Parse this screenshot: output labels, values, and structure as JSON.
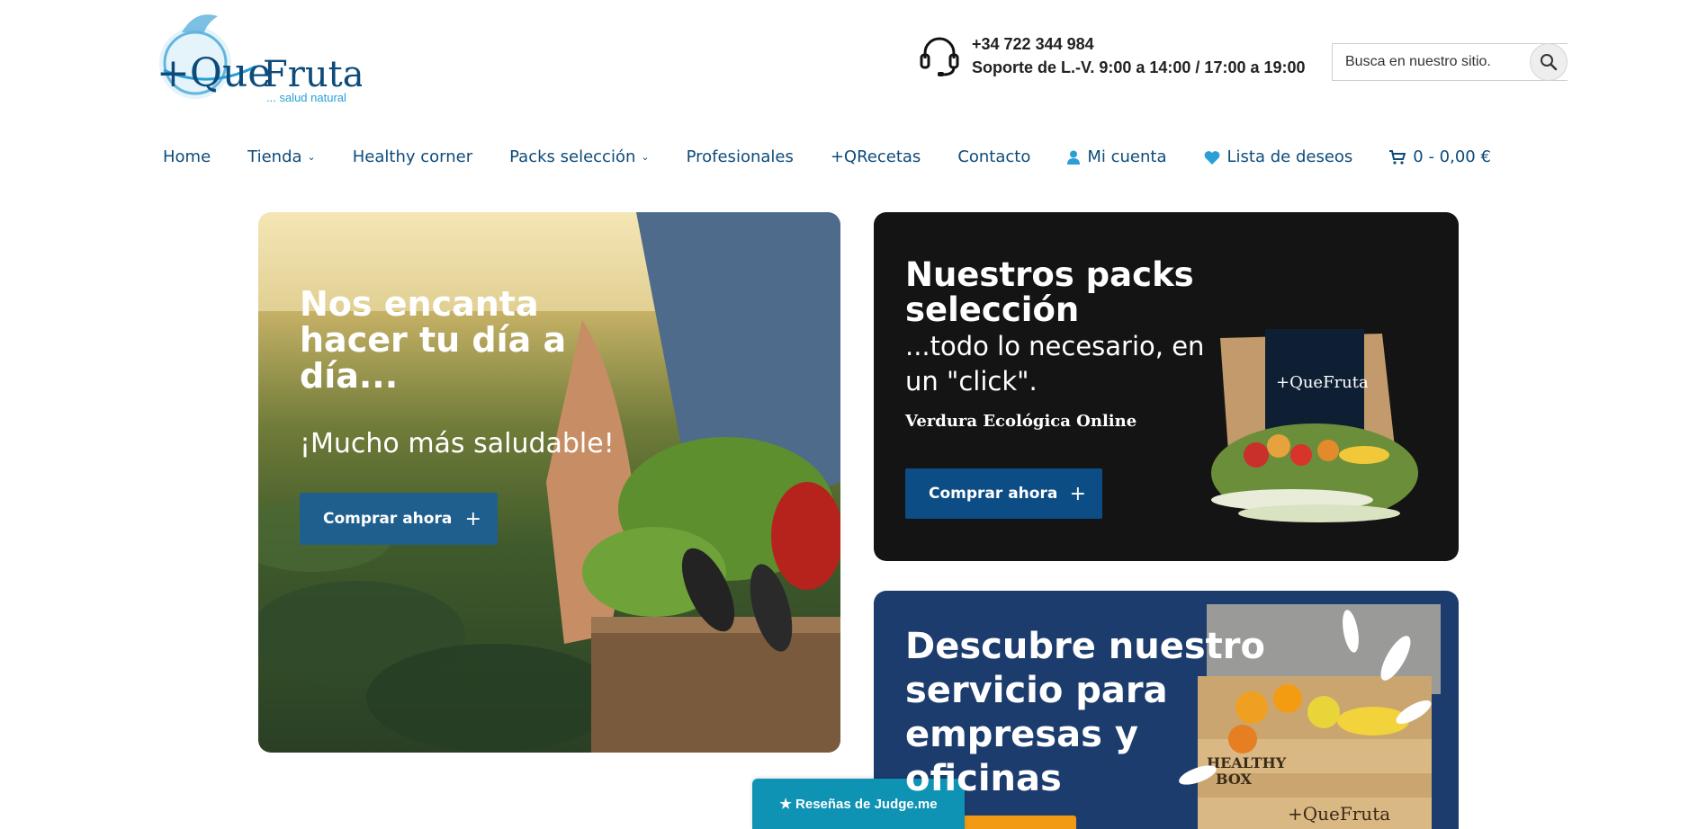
{
  "brand": {
    "name_prefix": "+Que",
    "name_suffix": "Fruta",
    "tagline": "... salud natural",
    "primary_color": "#0d4b7a",
    "accent_color": "#2a9fd6"
  },
  "header": {
    "phone": "+34 722 344 984",
    "hours": "Soporte de L.-V. 9:00 a 14:00 / 17:00 a 19:00",
    "headset_icon": "headset-icon",
    "search_placeholder": "Busca en nuestro sitio.",
    "search_icon": "search-icon"
  },
  "nav": {
    "home": "Home",
    "tienda": "Tienda",
    "healthy": "Healthy corner",
    "packs": "Packs selección",
    "profesionales": "Profesionales",
    "recetas": "+QRecetas",
    "contacto": "Contacto",
    "cuenta": "Mi cuenta",
    "deseos": "Lista de deseos",
    "cart": "0 - 0,00 €"
  },
  "hero": {
    "title": "Nos encanta hacer tu día a día...",
    "subtitle": "¡Mucho más saludable!",
    "button": "Comprar ahora",
    "button_icon": "+"
  },
  "packs": {
    "title": "Nuestros packs selección",
    "subtitle": "...todo lo necesario, en un \"click\".",
    "tag": "Verdura Ecológica Online",
    "button": "Comprar ahora",
    "button_icon": "+",
    "box_brand": "+QueFruta"
  },
  "empresas": {
    "title": "Descubre nuestro servicio para empresas y oficinas",
    "crate_label_1": "HEALTHY",
    "crate_label_2": "BOX",
    "crate_brand": "+QueFruta"
  },
  "reviews_widget": {
    "label": "★ Reseñas de Judge.me"
  }
}
